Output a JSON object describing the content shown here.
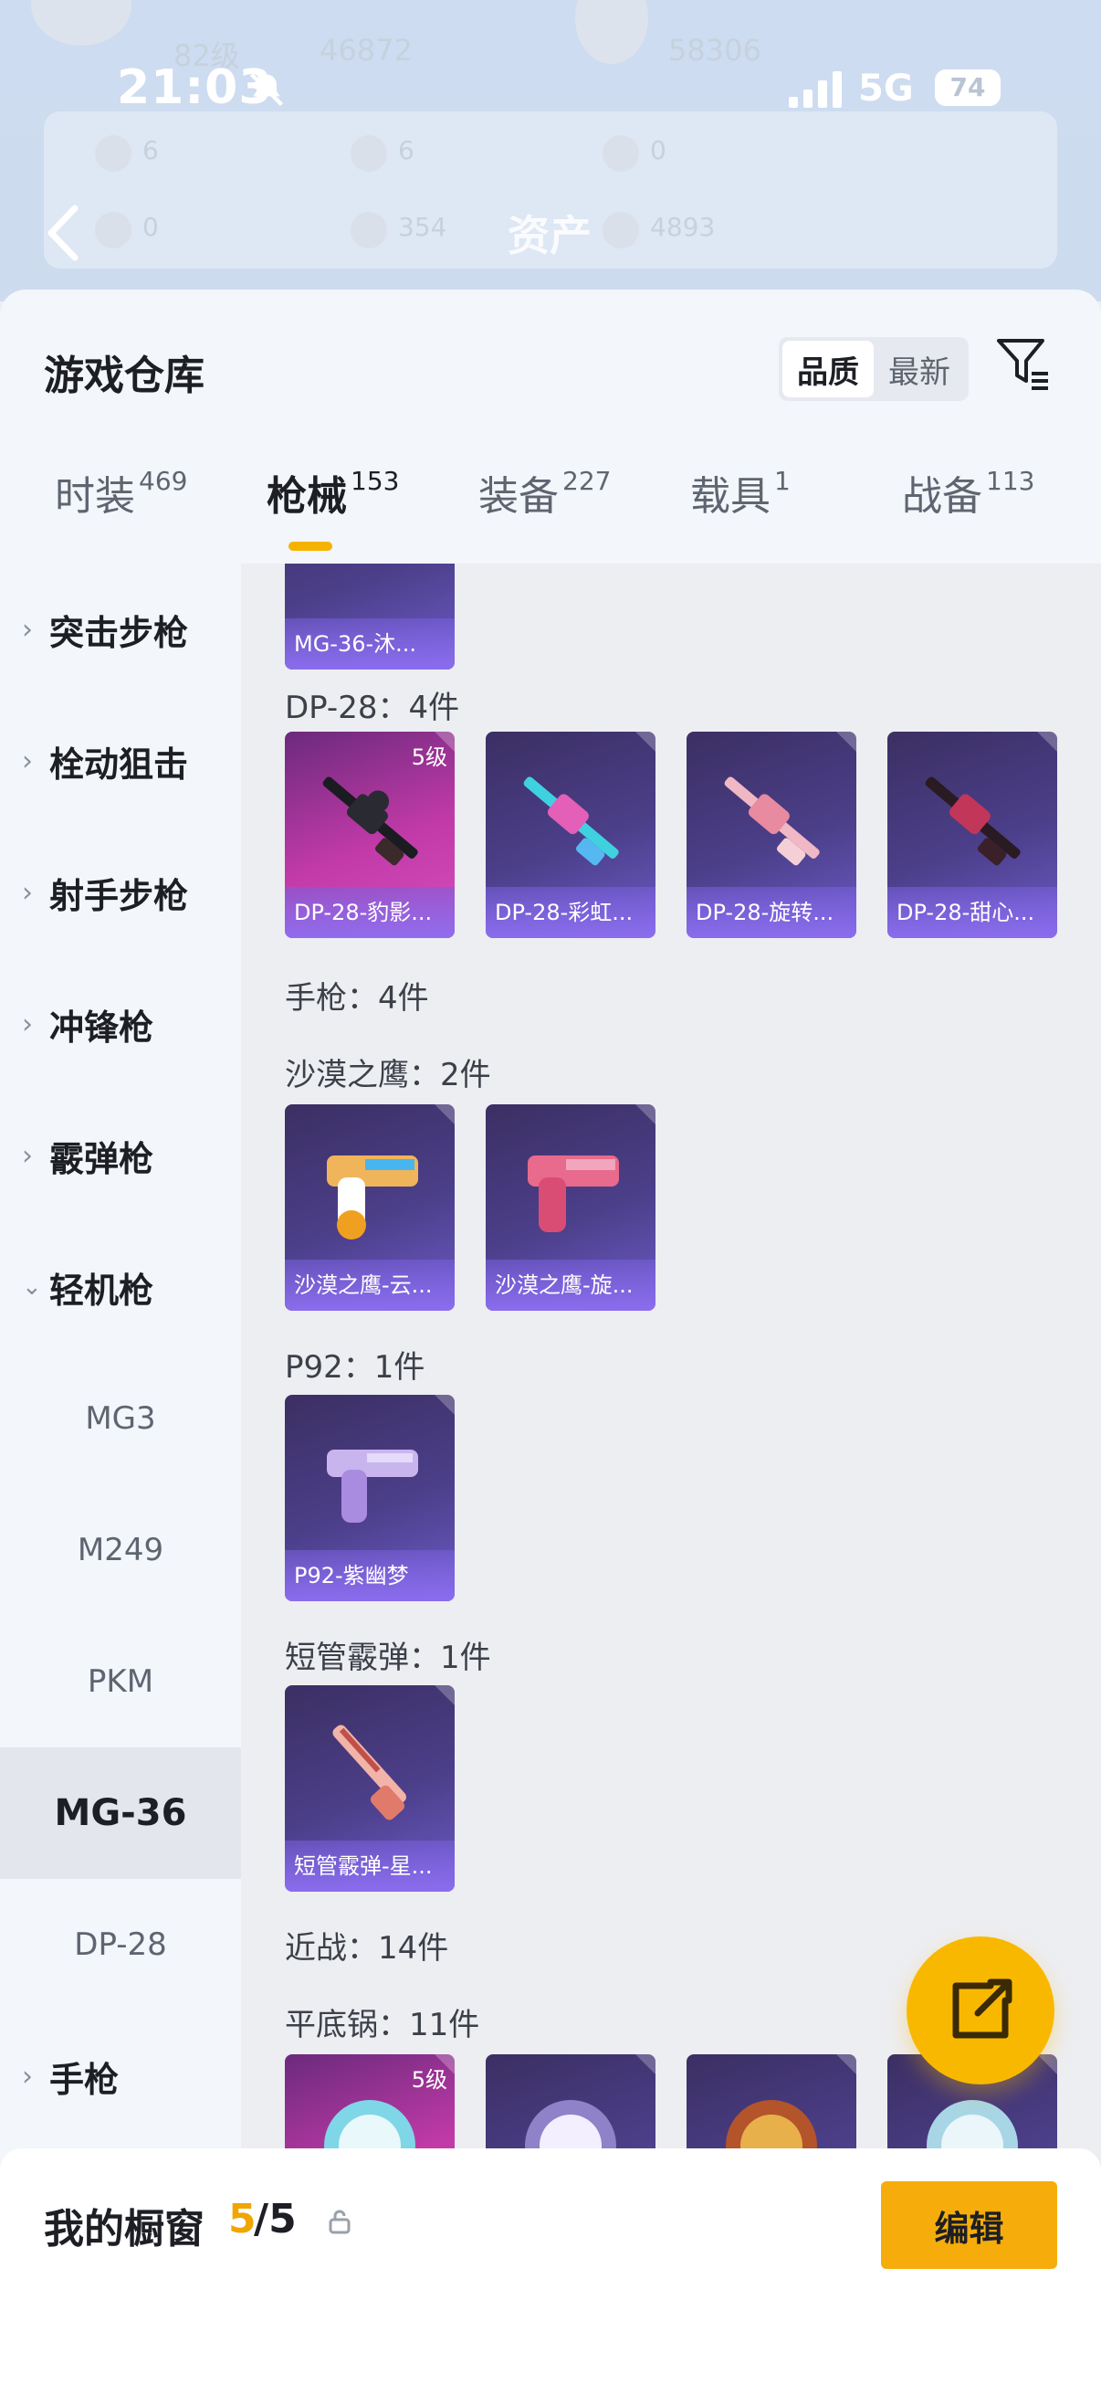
{
  "status_bar": {
    "time": "21:03",
    "network": "5G",
    "battery": "74"
  },
  "background_header": {
    "page_title": "资产",
    "ghost_texts": [
      "82级",
      "46872",
      "58306",
      "6",
      "6",
      "0",
      "0",
      "354",
      "4893"
    ]
  },
  "sheet": {
    "title": "游戏仓库",
    "sort_options": [
      "品质",
      "最新"
    ],
    "sort_selected": "品质"
  },
  "tabs": [
    {
      "label": "时装",
      "count": "469"
    },
    {
      "label": "枪械",
      "count": "153",
      "active": true
    },
    {
      "label": "装备",
      "count": "227"
    },
    {
      "label": "载具",
      "count": "1"
    },
    {
      "label": "战备",
      "count": "113"
    }
  ],
  "left_nav": [
    {
      "label": "突击步枪",
      "type": "group"
    },
    {
      "label": "栓动狙击",
      "type": "group"
    },
    {
      "label": "射手步枪",
      "type": "group"
    },
    {
      "label": "冲锋枪",
      "type": "group"
    },
    {
      "label": "霰弹枪",
      "type": "group"
    },
    {
      "label": "轻机枪",
      "type": "group",
      "expanded": true
    },
    {
      "label": "MG3",
      "type": "sub"
    },
    {
      "label": "M249",
      "type": "sub"
    },
    {
      "label": "PKM",
      "type": "sub"
    },
    {
      "label": "MG-36",
      "type": "sub",
      "selected": true
    },
    {
      "label": "DP-28",
      "type": "sub"
    },
    {
      "label": "手枪",
      "type": "group"
    }
  ],
  "content": {
    "partial_card": "MG-36-沐...",
    "sections": [
      {
        "label": "DP-28：4件",
        "cards": [
          {
            "name": "DP-28-豹影...",
            "level": "5级",
            "rarity": "pink"
          },
          {
            "name": "DP-28-彩虹...",
            "rarity": "purple"
          },
          {
            "name": "DP-28-旋转...",
            "rarity": "purple"
          },
          {
            "name": "DP-28-甜心...",
            "rarity": "purple"
          }
        ]
      },
      {
        "label": "手枪：4件",
        "cards": []
      },
      {
        "label": "沙漠之鹰：2件",
        "cards": [
          {
            "name": "沙漠之鹰-云...",
            "rarity": "purple"
          },
          {
            "name": "沙漠之鹰-旋...",
            "rarity": "purple"
          }
        ]
      },
      {
        "label": "P92：1件",
        "cards": [
          {
            "name": "P92-紫幽梦",
            "rarity": "purple"
          }
        ]
      },
      {
        "label": "短管霰弹：1件",
        "cards": [
          {
            "name": "短管霰弹-星...",
            "rarity": "purple"
          }
        ]
      },
      {
        "label": "近战：14件",
        "cards": []
      },
      {
        "label": "平底锅：11件",
        "cards": [
          {
            "name": "",
            "level": "5级",
            "rarity": "pink"
          },
          {
            "name": "",
            "rarity": "purple"
          },
          {
            "name": "",
            "rarity": "purple"
          },
          {
            "name": "",
            "rarity": "purple"
          }
        ]
      }
    ]
  },
  "showcase": {
    "label": "我的橱窗",
    "count": "5",
    "total": "/5",
    "edit_label": "编辑"
  },
  "icons": [
    "bell-mute-icon",
    "signal-icon",
    "back-icon",
    "filter-icon",
    "lock-icon",
    "share-icon",
    "chevron-right-icon",
    "chevron-down-icon"
  ],
  "colors": {
    "accent": "#f5b300",
    "purple_card": "#4c3f8a",
    "pink_card": "#c23aa8"
  }
}
